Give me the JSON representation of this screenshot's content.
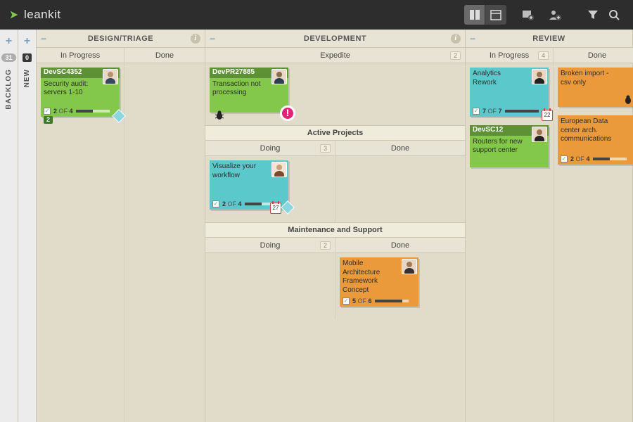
{
  "brand": "leankit",
  "rails": {
    "backlog": {
      "label": "BACKLOG",
      "count": 31
    },
    "new": {
      "label": "NEW",
      "count": 0
    }
  },
  "lanes": {
    "design": {
      "title": "DESIGN/TRIAGE",
      "cols": {
        "in_progress": "In Progress",
        "done": "Done"
      }
    },
    "dev": {
      "title": "DEVELOPMENT",
      "expedite": {
        "label": "Expedite",
        "count": 2
      },
      "active": {
        "title": "Active Projects",
        "doing": {
          "label": "Doing",
          "count": 3
        },
        "done": {
          "label": "Done"
        }
      },
      "maint": {
        "title": "Maintenance and Support",
        "doing": {
          "label": "Doing",
          "count": 2
        },
        "done": {
          "label": "Done"
        }
      }
    },
    "review": {
      "title": "REVIEW",
      "cols": {
        "in_progress": {
          "label": "In Progress",
          "count": 4
        },
        "done": "Done"
      }
    }
  },
  "cards": {
    "c1": {
      "hdr": "DevSC4352",
      "title": "Security audit: servers 1-10",
      "done": 2,
      "total": 4,
      "pill": "2"
    },
    "c2": {
      "hdr": "DevPR27885",
      "title": "Transaction not processing"
    },
    "c3": {
      "title": "Visualize your workflow",
      "done": 2,
      "total": 4,
      "cal": "27"
    },
    "c4": {
      "title": "Mobile Architecture Framework Concept",
      "done": 5,
      "total": 6
    },
    "c5": {
      "title": "Analytics Rework",
      "done": 7,
      "total": 7,
      "cal": "22"
    },
    "c6": {
      "hdr": "DevSC12",
      "title": "Routers for new support center"
    },
    "c7": {
      "title": "Broken import - csv only"
    },
    "c8": {
      "title": "European Data center arch. communications",
      "done": 2,
      "total": 4
    }
  },
  "text_of": "OF"
}
